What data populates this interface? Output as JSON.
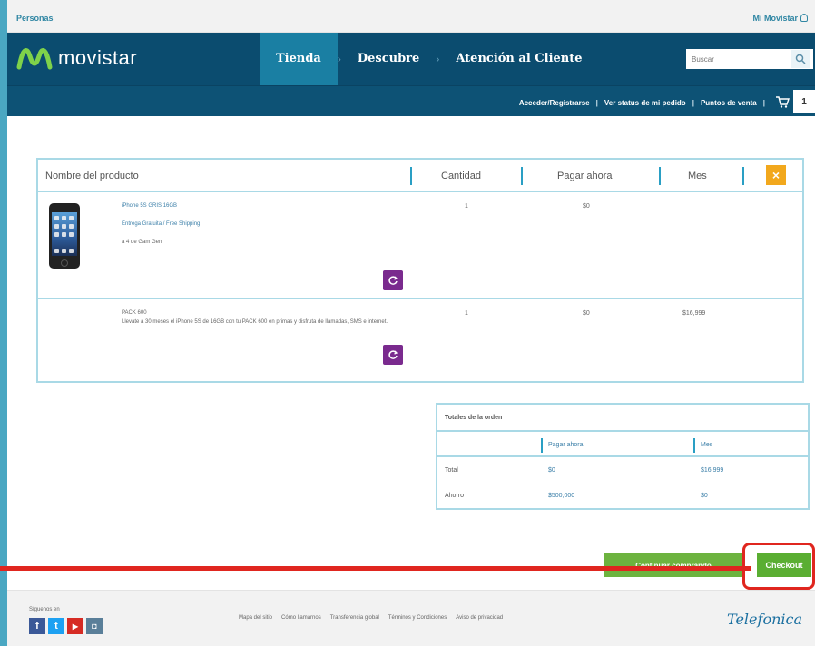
{
  "topbar": {
    "personas": "Personas",
    "mi_movistar": "Mi Movistar"
  },
  "header": {
    "logo_text": "movistar",
    "nav": [
      "Tienda",
      "Descubre",
      "Atención al Cliente"
    ],
    "search_placeholder": "Buscar"
  },
  "subnav": {
    "login": "Acceder/Registrarse",
    "order_status": "Ver status de mi pedido",
    "points_of_sale": "Puntos de venta",
    "cart_count": "1"
  },
  "cart_table": {
    "columns": [
      "Nombre del producto",
      "Cantidad",
      "Pagar ahora",
      "Mes"
    ],
    "close_label": "×",
    "products": [
      {
        "lines": [
          "iPhone 5S GRIS 16GB",
          "Entrega Gratuita / Free Shipping",
          "a 4 de Gam Gen"
        ],
        "quantity": "1",
        "pay_now": "$0",
        "month": ""
      },
      {
        "lines": [
          "PACK 600",
          "Llevate a 30 meses el iPhone 5S de 16GB con tu PACK 600 en primas y disfruta de llamadas, SMS e internet."
        ],
        "quantity": "1",
        "pay_now": "$0",
        "month": "$16,999"
      }
    ]
  },
  "totals": {
    "title": "Totales de la orden",
    "columns": [
      "Pagar ahora",
      "Mes"
    ],
    "rows": [
      {
        "label": "Total",
        "pay_now": "$0",
        "month": "$16,999"
      },
      {
        "label": "Ahorro",
        "pay_now": "$500,000",
        "month": "$0"
      }
    ]
  },
  "buttons": {
    "continue": "Continuar comprando",
    "checkout": "Checkout"
  },
  "footer": {
    "follow": "Síguenos en",
    "socials": [
      "f",
      "t",
      "▶",
      "◘"
    ],
    "links": [
      "Mapa del sitio",
      "Cómo llamarnos",
      "Transferencia global",
      "Términos y Condiciones",
      "Aviso de privacidad"
    ],
    "brand": "Telefonica"
  }
}
